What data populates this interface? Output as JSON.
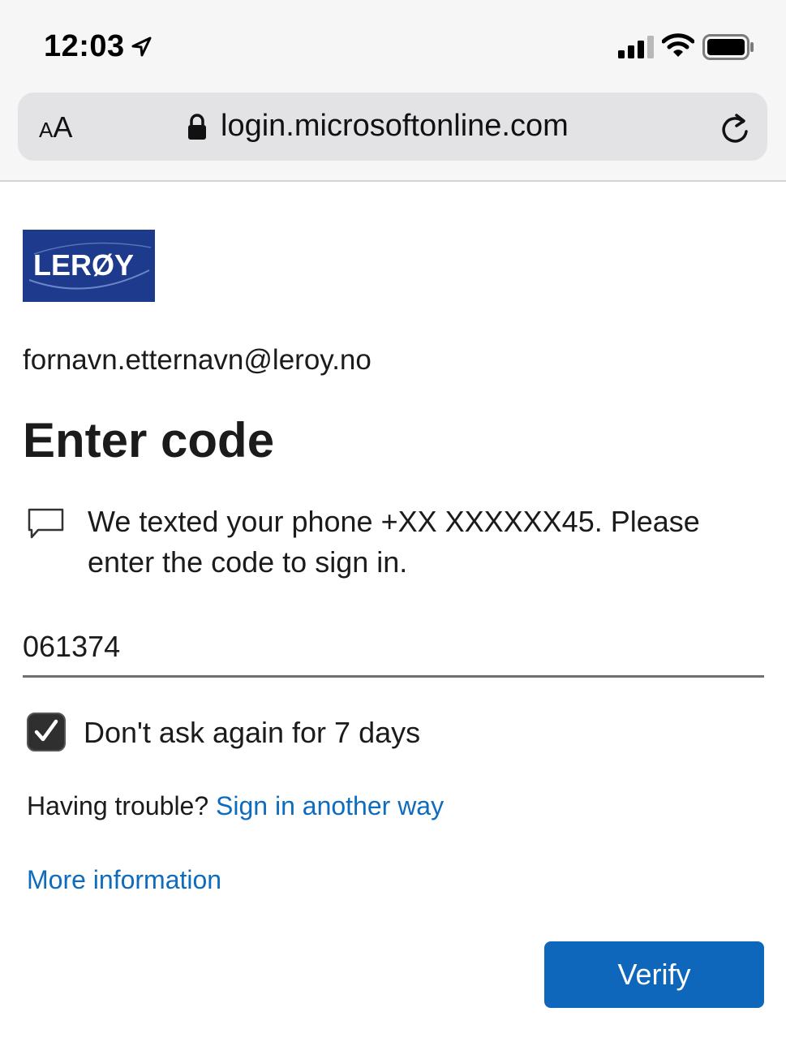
{
  "status_bar": {
    "time": "12:03",
    "location_icon": "location-arrow-icon",
    "signal_icon": "cellular-signal-icon",
    "wifi_icon": "wifi-icon",
    "battery_icon": "battery-icon"
  },
  "browser": {
    "text_size_label": "AA",
    "lock_icon": "lock-icon",
    "url": "login.microsoftonline.com",
    "reload_icon": "reload-icon"
  },
  "page": {
    "logo_text": "LERØY",
    "email": "fornavn.etternavn@leroy.no",
    "title": "Enter code",
    "message_icon": "sms-bubble-icon",
    "message": "We texted your phone +XX XXXXXX45. Please enter the code to sign in.",
    "code_value": "061374",
    "remember_checked": true,
    "remember_label": "Don't ask again for 7 days",
    "trouble_prefix": "Having trouble?",
    "trouble_link": "Sign in another way",
    "more_info_link": "More information",
    "verify_button": "Verify"
  },
  "colors": {
    "link": "#0f6cbd",
    "button": "#0f67bc",
    "logo_background": "#1d3a8c"
  }
}
